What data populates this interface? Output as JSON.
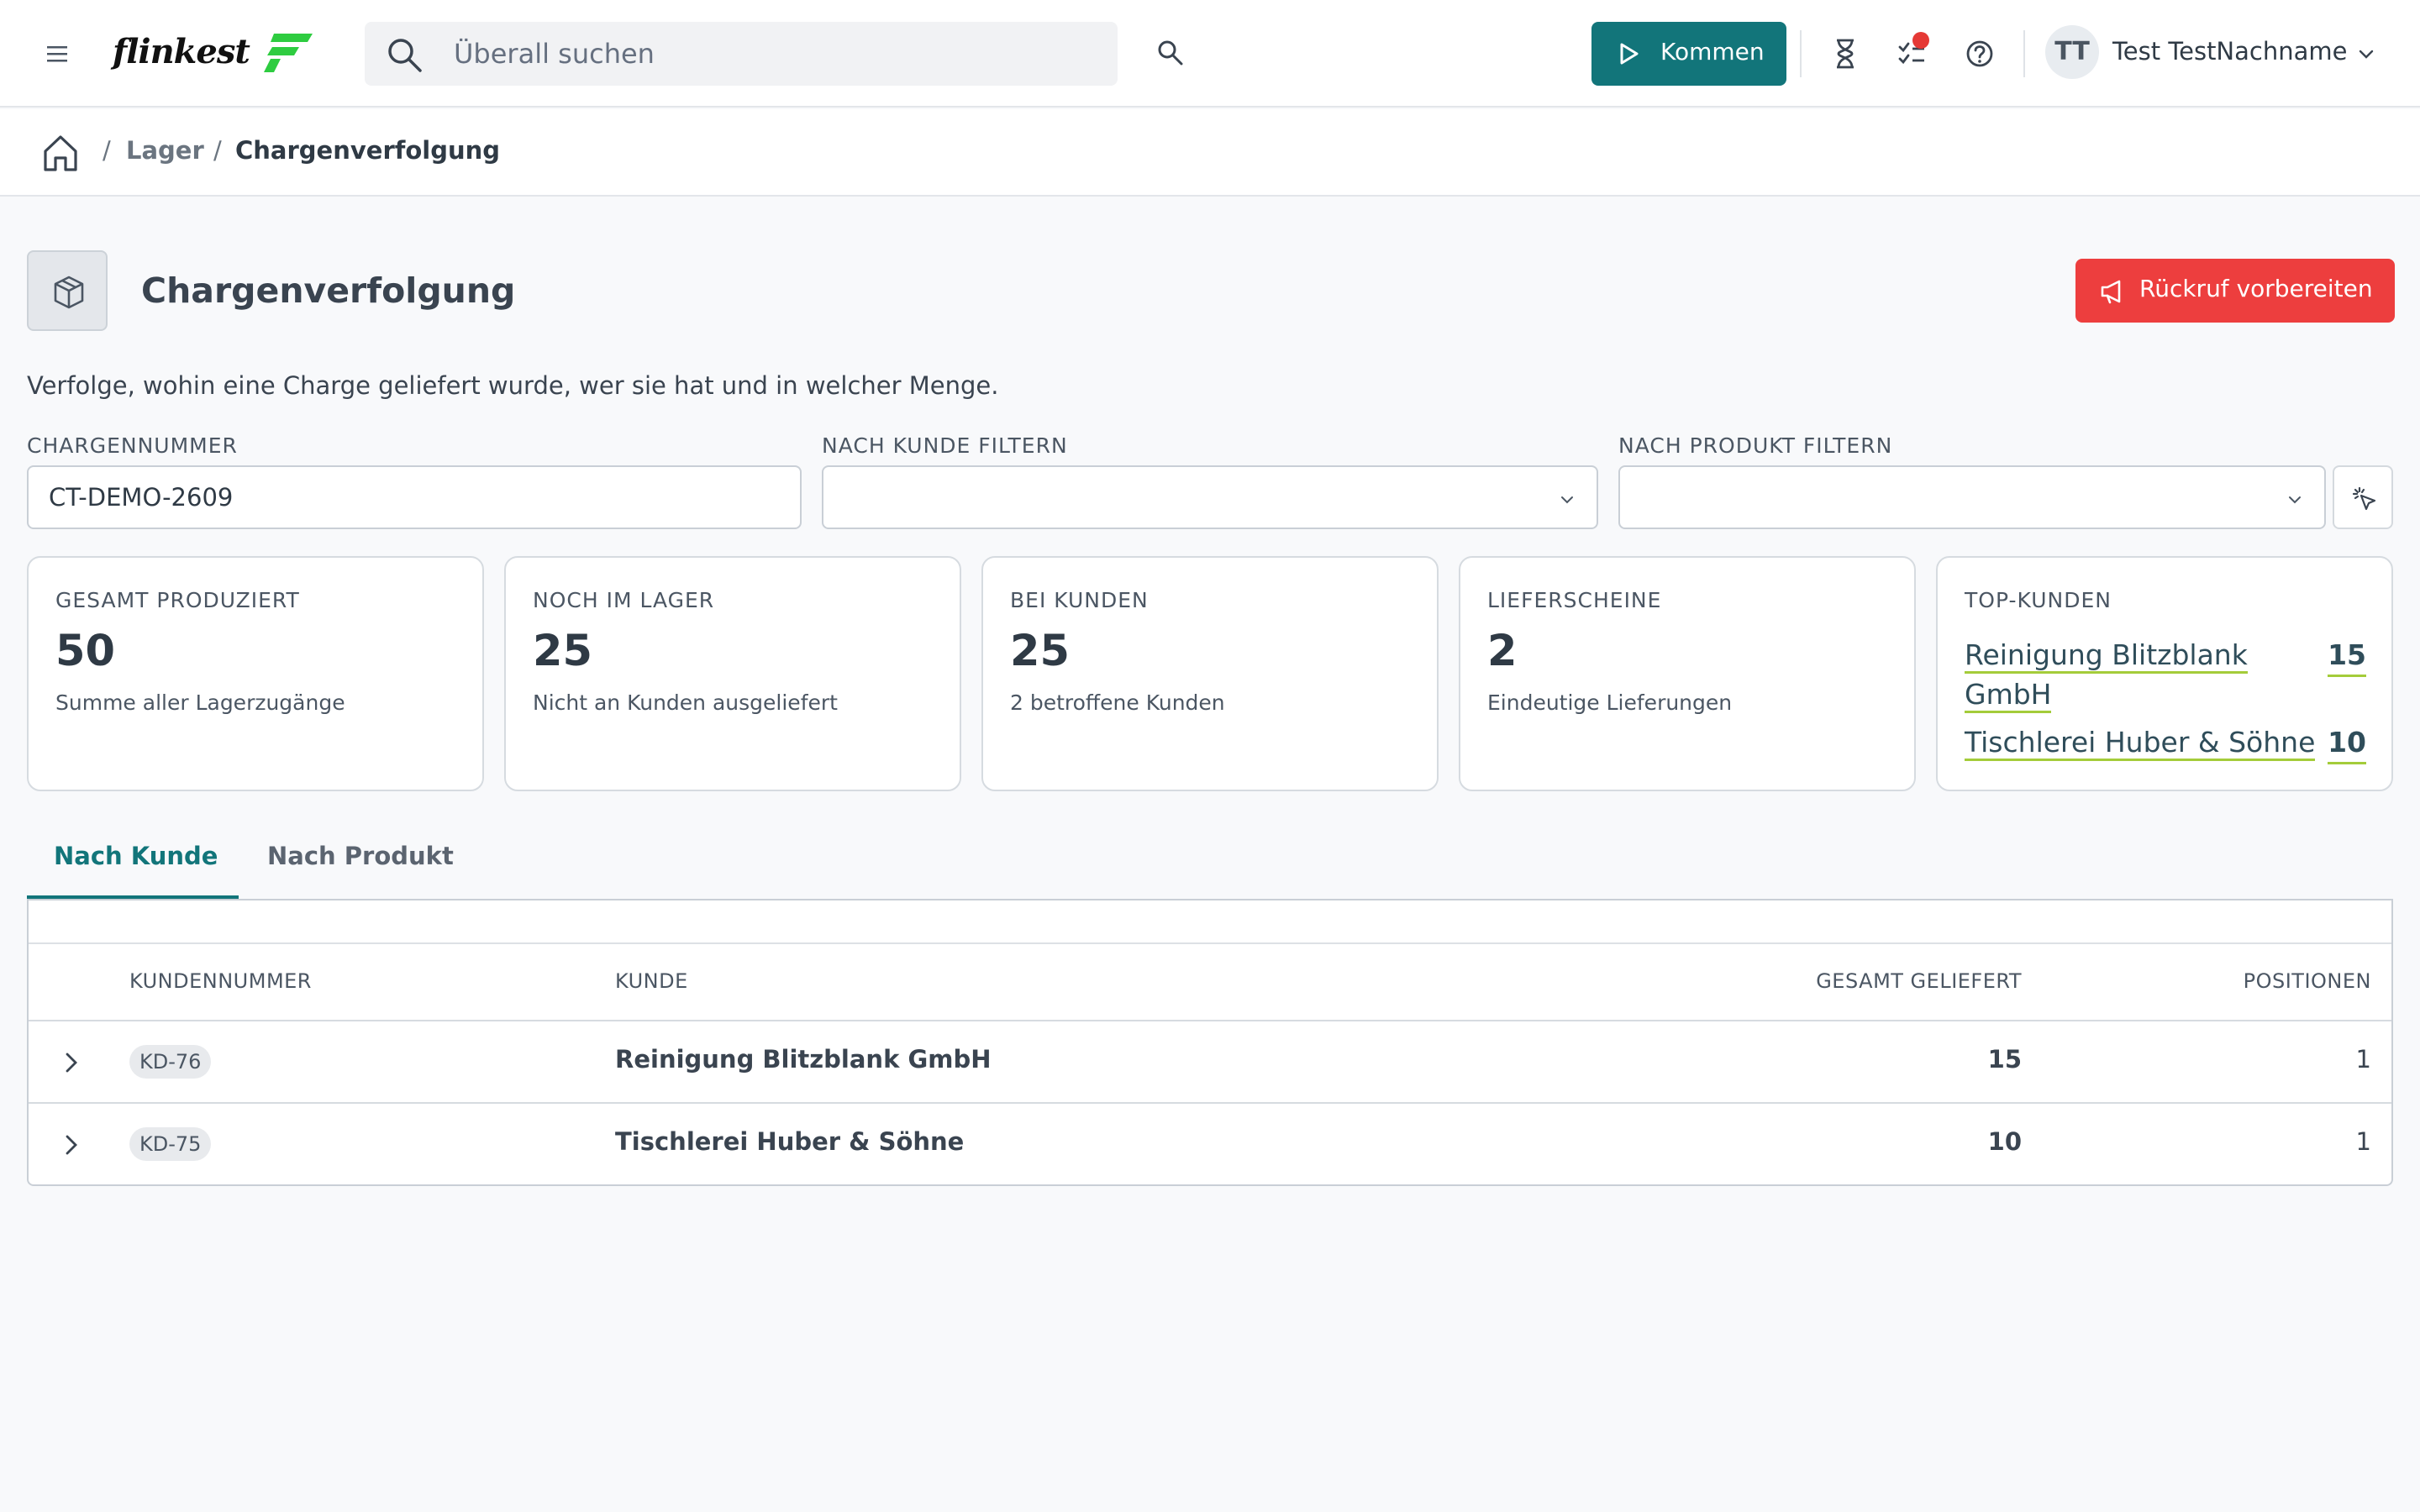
{
  "header": {
    "logo_text": "flinkest",
    "search_placeholder": "Überall suchen",
    "kommen_label": "Kommen",
    "user_initials": "TT",
    "user_name": "Test TestNachname"
  },
  "breadcrumb": {
    "items": [
      "Lager",
      "Chargenverfolgung"
    ],
    "separator": "/"
  },
  "page": {
    "title": "Chargenverfolgung",
    "recall_button": "Rückruf vorbereiten",
    "description": "Verfolge, wohin eine Charge geliefert wurde, wer sie hat und in welcher Menge."
  },
  "filters": {
    "batch_label": "CHARGENNUMMER",
    "batch_value": "CT-DEMO-2609",
    "customer_label": "NACH KUNDE FILTERN",
    "customer_value": "",
    "product_label": "NACH PRODUKT FILTERN",
    "product_value": ""
  },
  "cards": [
    {
      "label": "GESAMT PRODUZIERT",
      "value": "50",
      "sub": "Summe aller Lagerzugänge"
    },
    {
      "label": "NOCH IM LAGER",
      "value": "25",
      "sub": "Nicht an Kunden ausgeliefert"
    },
    {
      "label": "BEI KUNDEN",
      "value": "25",
      "sub": "2 betroffene Kunden"
    },
    {
      "label": "LIEFERSCHEINE",
      "value": "2",
      "sub": "Eindeutige Lieferungen"
    }
  ],
  "top_customers": {
    "label": "TOP-KUNDEN",
    "items": [
      {
        "line1": "Reinigung Blitzblank",
        "line2": "GmbH",
        "qty": "15"
      },
      {
        "line1": "Tischlerei Huber & Söhne",
        "qty": "10"
      }
    ]
  },
  "tabs": [
    {
      "label": "Nach Kunde",
      "active": true
    },
    {
      "label": "Nach Produkt",
      "active": false
    }
  ],
  "table": {
    "headers": {
      "customer_no": "KUNDENNUMMER",
      "customer": "KUNDE",
      "total": "GESAMT GELIEFERT",
      "positions": "POSITIONEN"
    },
    "rows": [
      {
        "customer_no": "KD-76",
        "customer": "Reinigung Blitzblank GmbH",
        "total": "15",
        "positions": "1"
      },
      {
        "customer_no": "KD-75",
        "customer": "Tischlerei Huber & Söhne",
        "total": "10",
        "positions": "1"
      }
    ]
  },
  "colors": {
    "primary": "#12757a",
    "danger": "#ed3e3e",
    "logo_green": "#2ecc40",
    "underline_accent": "#a4cc3a",
    "notification": "#e53935"
  }
}
